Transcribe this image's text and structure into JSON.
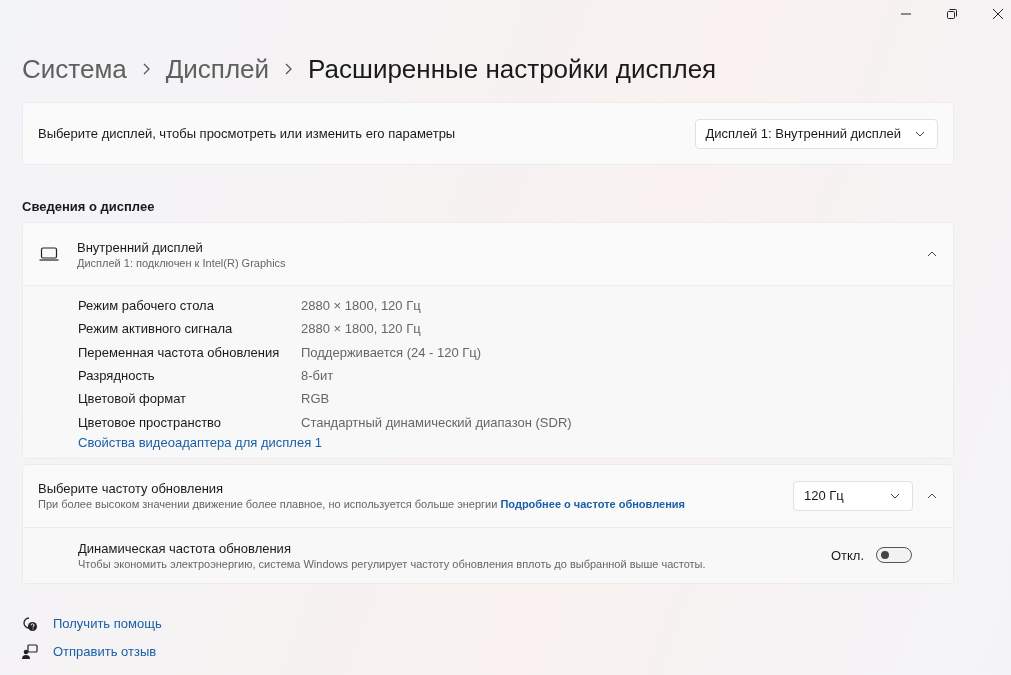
{
  "breadcrumb": [
    {
      "label": "Система",
      "selected": false
    },
    {
      "label": "Дисплей",
      "selected": false
    },
    {
      "label": "Расширенные настройки дисплея",
      "selected": true
    }
  ],
  "display_select": {
    "label": "Выберите дисплей, чтобы просмотреть или изменить его параметры",
    "value": "Дисплей 1: Внутренний дисплей"
  },
  "section_title": "Сведения о дисплее",
  "display_info": {
    "title": "Внутренний дисплей",
    "subtitle": "Дисплей 1: подключен к Intel(R) Graphics",
    "expanded": true,
    "rows": [
      {
        "label": "Режим рабочего стола",
        "value": "2880 × 1800, 120 Гц"
      },
      {
        "label": "Режим активного сигнала",
        "value": "2880 × 1800, 120 Гц"
      },
      {
        "label": "Переменная частота обновления",
        "value": "Поддерживается (24 - 120 Гц)"
      },
      {
        "label": "Разрядность",
        "value": "8-бит"
      },
      {
        "label": "Цветовой формат",
        "value": "RGB"
      },
      {
        "label": "Цветовое пространство",
        "value": "Стандартный динамический диапазон (SDR)"
      }
    ],
    "link": "Свойства видеоадаптера для дисплея 1"
  },
  "refresh_rate": {
    "title": "Выберите частоту обновления",
    "description": "При более высоком значении движение более плавное, но используется больше энергии",
    "link": "Подробнее о частоте обновления",
    "value": "120 Гц",
    "expanded": true,
    "dynamic": {
      "title": "Динамическая частота обновления",
      "description": "Чтобы экономить электроэнергию, система Windows регулирует частоту обновления вплоть до выбранной выше частоты.",
      "state_label": "Откл.",
      "on": false
    }
  },
  "footer_links": [
    {
      "kind": "help",
      "label": "Получить помощь"
    },
    {
      "kind": "feedback",
      "label": "Отправить отзыв"
    }
  ]
}
